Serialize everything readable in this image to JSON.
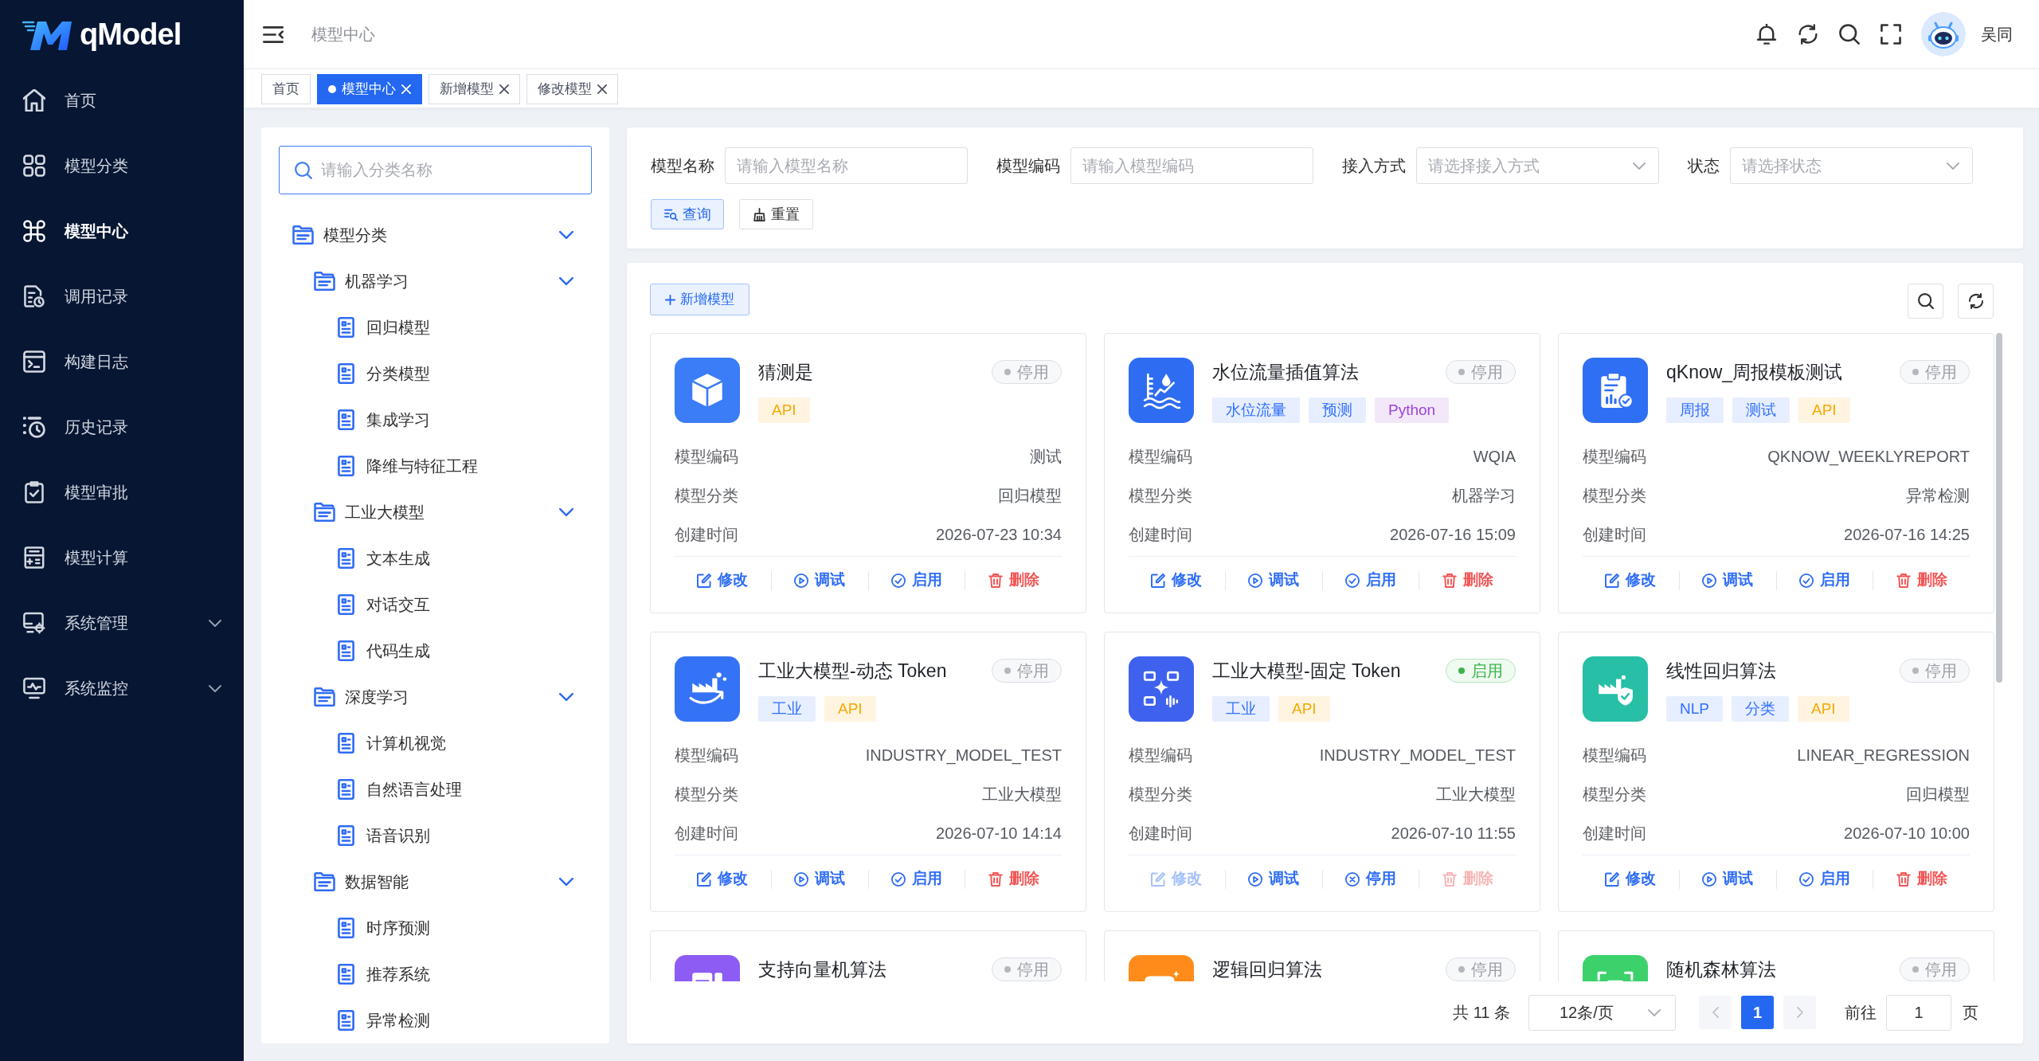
{
  "sidebar": {
    "logo": "qModel",
    "items": [
      {
        "label": "首页",
        "kind": "item",
        "selected": false
      },
      {
        "label": "模型分类",
        "kind": "item",
        "selected": false
      },
      {
        "label": "模型中心",
        "kind": "item",
        "selected": true
      },
      {
        "label": "调用记录",
        "kind": "item",
        "selected": false
      },
      {
        "label": "构建日志",
        "kind": "item",
        "selected": false
      },
      {
        "label": "历史记录",
        "kind": "item",
        "selected": false
      },
      {
        "label": "模型审批",
        "kind": "item",
        "selected": false
      },
      {
        "label": "模型计算",
        "kind": "item",
        "selected": false
      },
      {
        "label": "系统管理",
        "kind": "submenu",
        "selected": false,
        "expanded": false
      },
      {
        "label": "系统监控",
        "kind": "submenu",
        "selected": false,
        "expanded": false
      }
    ]
  },
  "header": {
    "breadcrumb": "模型中心",
    "user": "吴同"
  },
  "tabs": [
    {
      "label": "首页",
      "selected": false,
      "closable": false
    },
    {
      "label": "模型中心",
      "selected": true,
      "closable": true
    },
    {
      "label": "新增模型",
      "selected": false,
      "closable": true
    },
    {
      "label": "修改模型",
      "selected": false,
      "closable": true
    }
  ],
  "category_panel": {
    "search": {
      "placeholder": "请输入分类名称"
    },
    "tree": [
      {
        "label": "模型分类",
        "expanded": true,
        "children": [
          {
            "label": "机器学习",
            "expanded": true,
            "children": [
              {
                "label": "回归模型"
              },
              {
                "label": "分类模型"
              },
              {
                "label": "集成学习"
              },
              {
                "label": "降维与特征工程"
              }
            ]
          },
          {
            "label": "工业大模型",
            "expanded": true,
            "children": [
              {
                "label": "文本生成"
              },
              {
                "label": "对话交互"
              },
              {
                "label": "代码生成"
              }
            ]
          },
          {
            "label": "深度学习",
            "expanded": true,
            "children": [
              {
                "label": "计算机视觉"
              },
              {
                "label": "自然语言处理"
              },
              {
                "label": "语音识别"
              }
            ]
          },
          {
            "label": "数据智能",
            "expanded": true,
            "children": [
              {
                "label": "时序预测"
              },
              {
                "label": "推荐系统"
              },
              {
                "label": "异常检测"
              }
            ]
          }
        ]
      }
    ]
  },
  "filters": {
    "fields": [
      {
        "label": "模型名称",
        "kind": "input",
        "placeholder": "请输入模型名称"
      },
      {
        "label": "模型编码",
        "kind": "input",
        "placeholder": "请输入模型编码"
      },
      {
        "label": "接入方式",
        "kind": "select",
        "placeholder": "请选择接入方式"
      },
      {
        "label": "状态",
        "kind": "select",
        "placeholder": "请选择状态"
      }
    ],
    "buttons": [
      {
        "label": "查询",
        "kind": "primary"
      },
      {
        "label": "重置",
        "kind": "default"
      }
    ]
  },
  "model_list": {
    "add_button": "新增模型",
    "cards": [
      {
        "title": "猜测是",
        "color": "#3b7cf7",
        "status": "停用",
        "enabled": false,
        "tags": [
          {
            "label": "API",
            "color": "#f5a800"
          }
        ],
        "fields": [
          {
            "label": "模型编码",
            "value": "测试"
          },
          {
            "label": "模型分类",
            "value": "回归模型"
          },
          {
            "label": "创建时间",
            "value": "2026-07-23 10:34"
          }
        ],
        "actions": [
          {
            "label": "修改",
            "kind": "edit",
            "disabled": false
          },
          {
            "label": "调试",
            "kind": "debug",
            "disabled": false
          },
          {
            "label": "启用",
            "kind": "enable",
            "disabled": false
          },
          {
            "label": "删除",
            "kind": "delete",
            "disabled": false
          }
        ]
      },
      {
        "title": "水位流量插值算法",
        "color": "#2e6cf2",
        "status": "停用",
        "enabled": false,
        "tags": [
          {
            "label": "水位流量",
            "color": "#3370ff"
          },
          {
            "label": "预测",
            "color": "#3370ff"
          },
          {
            "label": "Python",
            "color": "#9b45d6"
          }
        ],
        "fields": [
          {
            "label": "模型编码",
            "value": "WQIA"
          },
          {
            "label": "模型分类",
            "value": "机器学习"
          },
          {
            "label": "创建时间",
            "value": "2026-07-16 15:09"
          }
        ],
        "actions": [
          {
            "label": "修改",
            "kind": "edit",
            "disabled": false
          },
          {
            "label": "调试",
            "kind": "debug",
            "disabled": false
          },
          {
            "label": "启用",
            "kind": "enable",
            "disabled": false
          },
          {
            "label": "删除",
            "kind": "delete",
            "disabled": false
          }
        ]
      },
      {
        "title": "qKnow_周报模板测试",
        "color": "#2f6ff4",
        "status": "停用",
        "enabled": false,
        "tags": [
          {
            "label": "周报",
            "color": "#3370ff"
          },
          {
            "label": "测试",
            "color": "#3370ff"
          },
          {
            "label": "API",
            "color": "#f5a800"
          }
        ],
        "fields": [
          {
            "label": "模型编码",
            "value": "QKNOW_WEEKLYREPORT"
          },
          {
            "label": "模型分类",
            "value": "异常检测"
          },
          {
            "label": "创建时间",
            "value": "2026-07-16 14:25"
          }
        ],
        "actions": [
          {
            "label": "修改",
            "kind": "edit",
            "disabled": false
          },
          {
            "label": "调试",
            "kind": "debug",
            "disabled": false
          },
          {
            "label": "启用",
            "kind": "enable",
            "disabled": false
          },
          {
            "label": "删除",
            "kind": "delete",
            "disabled": false
          }
        ]
      },
      {
        "title": "工业大模型-动态 Token",
        "color": "#3473f5",
        "status": "停用",
        "enabled": false,
        "tags": [
          {
            "label": "工业",
            "color": "#3370ff"
          },
          {
            "label": "API",
            "color": "#f5a800"
          }
        ],
        "fields": [
          {
            "label": "模型编码",
            "value": "INDUSTRY_MODEL_TEST"
          },
          {
            "label": "模型分类",
            "value": "工业大模型"
          },
          {
            "label": "创建时间",
            "value": "2026-07-10 14:14"
          }
        ],
        "actions": [
          {
            "label": "修改",
            "kind": "edit",
            "disabled": false
          },
          {
            "label": "调试",
            "kind": "debug",
            "disabled": false
          },
          {
            "label": "启用",
            "kind": "enable",
            "disabled": false
          },
          {
            "label": "删除",
            "kind": "delete",
            "disabled": false
          }
        ]
      },
      {
        "title": "工业大模型-固定 Token",
        "color": "#3e62ee",
        "status": "启用",
        "enabled": true,
        "tags": [
          {
            "label": "工业",
            "color": "#3370ff"
          },
          {
            "label": "API",
            "color": "#f5a800"
          }
        ],
        "fields": [
          {
            "label": "模型编码",
            "value": "INDUSTRY_MODEL_TEST"
          },
          {
            "label": "模型分类",
            "value": "工业大模型"
          },
          {
            "label": "创建时间",
            "value": "2026-07-10 11:55"
          }
        ],
        "actions": [
          {
            "label": "修改",
            "kind": "edit",
            "disabled": true
          },
          {
            "label": "调试",
            "kind": "debug",
            "disabled": false
          },
          {
            "label": "停用",
            "kind": "disable",
            "disabled": false
          },
          {
            "label": "删除",
            "kind": "delete",
            "disabled": true
          }
        ]
      },
      {
        "title": "线性回归算法",
        "color": "#27bfa6",
        "status": "停用",
        "enabled": false,
        "tags": [
          {
            "label": "NLP",
            "color": "#3370ff"
          },
          {
            "label": "分类",
            "color": "#3370ff"
          },
          {
            "label": "API",
            "color": "#f5a800"
          }
        ],
        "fields": [
          {
            "label": "模型编码",
            "value": "LINEAR_REGRESSION"
          },
          {
            "label": "模型分类",
            "value": "回归模型"
          },
          {
            "label": "创建时间",
            "value": "2026-07-10 10:00"
          }
        ],
        "actions": [
          {
            "label": "修改",
            "kind": "edit",
            "disabled": false
          },
          {
            "label": "调试",
            "kind": "debug",
            "disabled": false
          },
          {
            "label": "启用",
            "kind": "enable",
            "disabled": false
          },
          {
            "label": "删除",
            "kind": "delete",
            "disabled": false
          }
        ]
      },
      {
        "title": "支持向量机算法",
        "color": "#8d5cf5",
        "status": "停用",
        "enabled": false
      },
      {
        "title": "逻辑回归算法",
        "color": "#ff8c1a",
        "status": "停用",
        "enabled": false
      },
      {
        "title": "随机森林算法",
        "color": "#3cd16b",
        "status": "停用",
        "enabled": false
      }
    ],
    "pagination": {
      "total": "共 11 条",
      "page_size": "12条/页",
      "pages": [
        {
          "label": "1",
          "selected": true
        }
      ],
      "goto": {
        "label": "前往",
        "value": "1",
        "suffix": "页"
      }
    }
  }
}
